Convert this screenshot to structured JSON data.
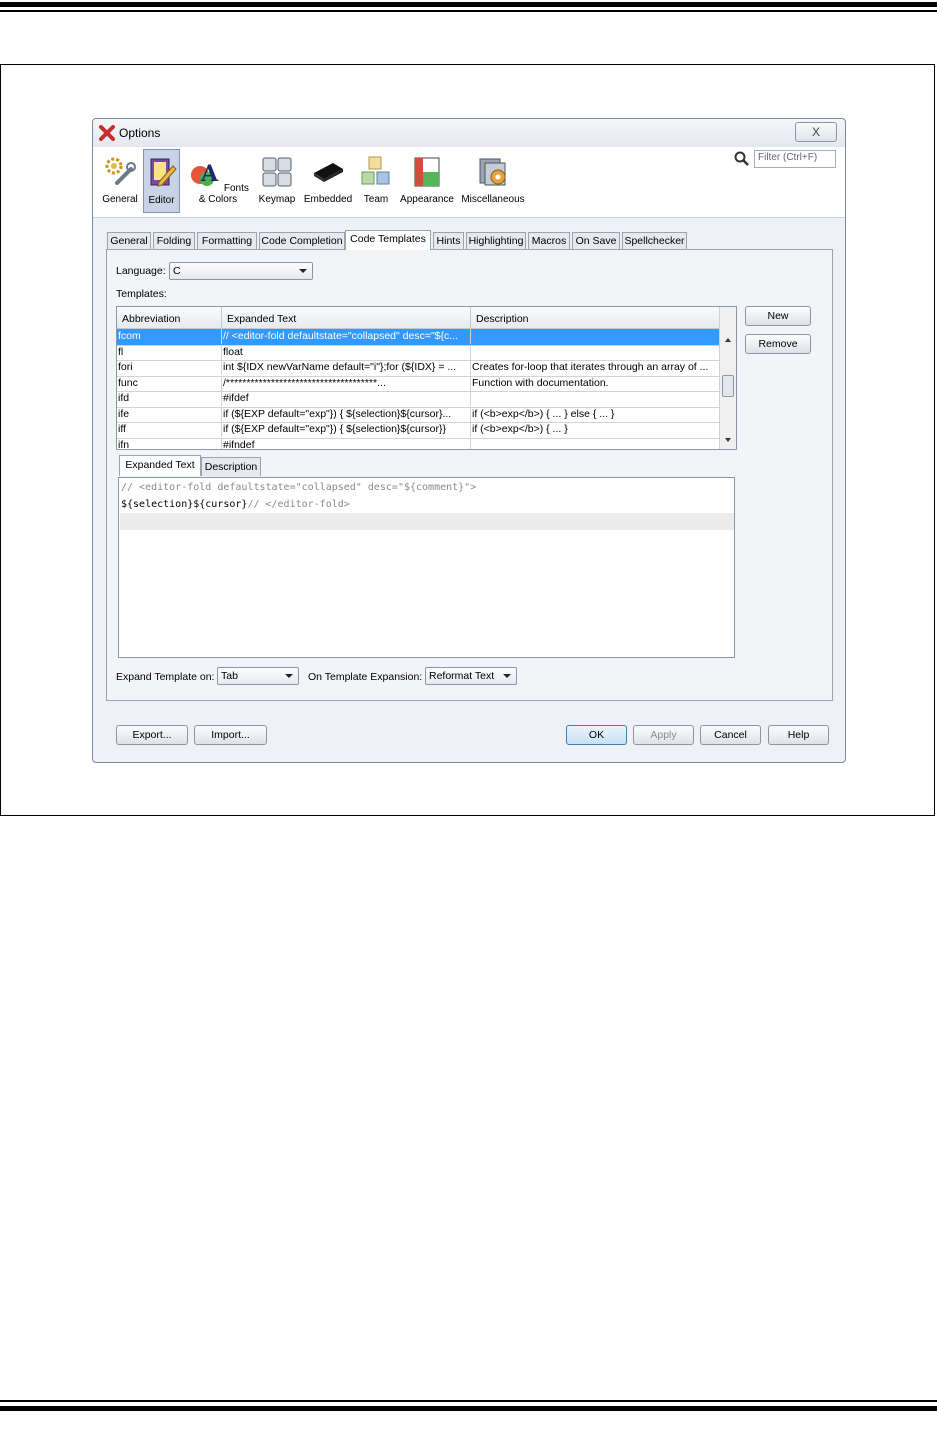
{
  "window": {
    "title": "Options",
    "close_label": "X"
  },
  "search": {
    "placeholder": "Filter (Ctrl+F)"
  },
  "categories": [
    {
      "label": "General",
      "icon": "gear-wrench-icon"
    },
    {
      "label": "Editor",
      "icon": "editor-pencil-icon",
      "selected": true
    },
    {
      "label": "Fonts & Colors",
      "icon": "fonts-colors-icon"
    },
    {
      "label": "Keymap",
      "icon": "keymap-icon"
    },
    {
      "label": "Embedded",
      "icon": "chip-icon"
    },
    {
      "label": "Team",
      "icon": "team-cubes-icon"
    },
    {
      "label": "Appearance",
      "icon": "appearance-icon"
    },
    {
      "label": "Miscellaneous",
      "icon": "miscellaneous-icon"
    }
  ],
  "tabs": [
    "General",
    "Folding",
    "Formatting",
    "Code Completion",
    "Code Templates",
    "Hints",
    "Highlighting",
    "Macros",
    "On Save",
    "Spellchecker"
  ],
  "active_tab": "Code Templates",
  "language": {
    "label": "Language:",
    "value": "C"
  },
  "templates_label": "Templates:",
  "table": {
    "headers": [
      "Abbreviation",
      "Expanded Text",
      "Description"
    ],
    "rows": [
      {
        "abbr": "fcom",
        "text": "// <editor-fold defaultstate=\"collapsed\" desc=\"${c...",
        "desc": "",
        "selected": true
      },
      {
        "abbr": "fl",
        "text": "float",
        "desc": ""
      },
      {
        "abbr": "fori",
        "text": "int ${IDX newVarName default=\"i\"};for (${IDX} = ...",
        "desc": "Creates for-loop that iterates through an array of ..."
      },
      {
        "abbr": "func",
        "text": "    /*************************************...",
        "desc": "Function with documentation."
      },
      {
        "abbr": "ifd",
        "text": "#ifdef",
        "desc": ""
      },
      {
        "abbr": "ife",
        "text": "if (${EXP default=\"exp\"}) {   ${selection}${cursor}...",
        "desc": "if (<b>exp</b>) { ... } else { ... }"
      },
      {
        "abbr": "iff",
        "text": "if (${EXP default=\"exp\"}) {   ${selection}${cursor}}",
        "desc": "if (<b>exp</b>) { ... }"
      },
      {
        "abbr": "ifn",
        "text": "#ifndef",
        "desc": ""
      }
    ]
  },
  "side_buttons": {
    "new": "New",
    "remove": "Remove"
  },
  "subtabs": {
    "expanded": "Expanded Text",
    "description": "Description"
  },
  "editor": {
    "line1": "// <editor-fold defaultstate=\"collapsed\" desc=\"${comment}\">",
    "line2_code": "${selection}${cursor}",
    "line2_comment": "// </editor-fold>"
  },
  "expand_on": {
    "label": "Expand Template on:",
    "value": "Tab"
  },
  "on_expansion": {
    "label": "On Template Expansion:",
    "value": "Reformat Text"
  },
  "footer": {
    "export": "Export...",
    "import": "Import...",
    "ok": "OK",
    "apply": "Apply",
    "cancel": "Cancel",
    "help": "Help"
  },
  "colors": {
    "selection": "#3399ff",
    "accent": "#7f93bb"
  }
}
